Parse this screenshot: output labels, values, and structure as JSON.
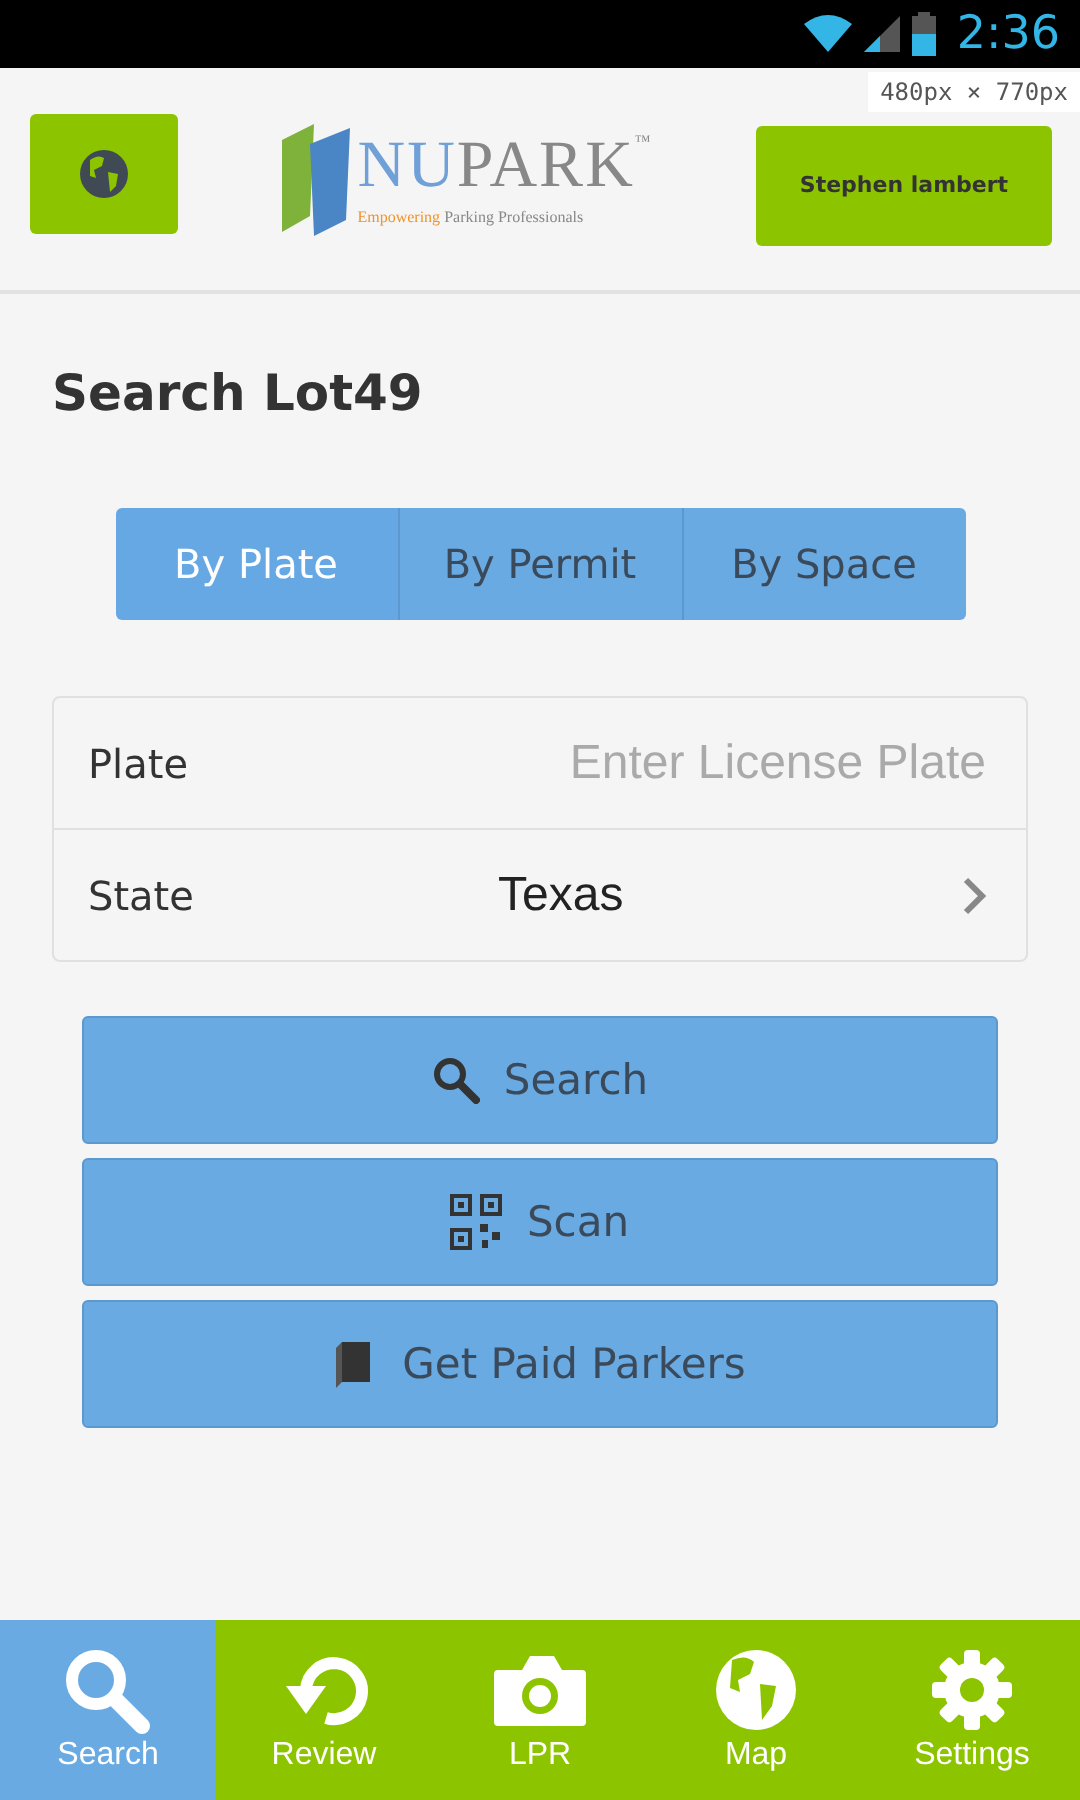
{
  "status_bar": {
    "time": "2:36"
  },
  "size_overlay": "480px × 770px",
  "header": {
    "user_button": "Stephen lambert",
    "logo": {
      "name_part1": "NU",
      "name_part2": "PARK",
      "trademark": "™",
      "tagline_highlight": "Empowering",
      "tagline_rest": "Parking Professionals"
    }
  },
  "title": "Search Lot49",
  "tabs": [
    {
      "label": "By Plate",
      "selected": true
    },
    {
      "label": "By Permit",
      "selected": false
    },
    {
      "label": "By Space",
      "selected": false
    }
  ],
  "form": {
    "rows": [
      {
        "kind": "input",
        "label": "Plate",
        "placeholder": "Enter License Plate"
      },
      {
        "kind": "select",
        "label": "State",
        "value": "Texas"
      }
    ]
  },
  "actions": [
    {
      "kind": "search",
      "label": "Search"
    },
    {
      "kind": "scan",
      "label": "Scan"
    },
    {
      "kind": "paid",
      "label": "Get Paid Parkers"
    }
  ],
  "bottom_nav": [
    {
      "kind": "search",
      "label": "Search",
      "selected": true
    },
    {
      "kind": "review",
      "label": "Review",
      "selected": false
    },
    {
      "kind": "camera",
      "label": "LPR",
      "selected": false
    },
    {
      "kind": "map",
      "label": "Map",
      "selected": false
    },
    {
      "kind": "settings",
      "label": "Settings",
      "selected": false
    }
  ]
}
